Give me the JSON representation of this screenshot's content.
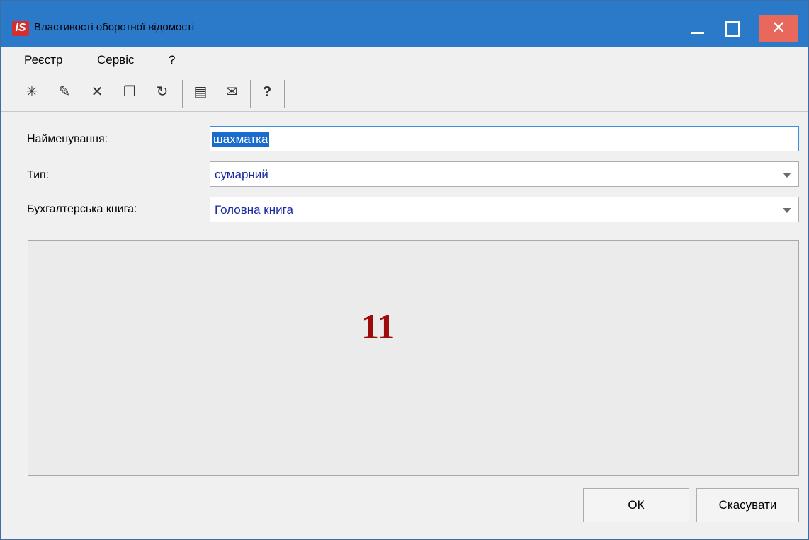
{
  "window": {
    "title": "Властивості оборотної відомості",
    "logo_text": "IS",
    "close_symbol": "✕"
  },
  "menu": {
    "items": [
      "Реєстр",
      "Сервіс",
      "?"
    ]
  },
  "toolbar": {
    "icons": [
      "new-doc-icon",
      "edit-doc-icon",
      "delete-doc-icon",
      "copy-doc-icon",
      "refresh-icon",
      "document-icon",
      "mail-icon",
      "help-icon"
    ],
    "glyphs": [
      "✳",
      "✎",
      "✕",
      "❐",
      "↻",
      "▤",
      "✉",
      "?"
    ]
  },
  "form": {
    "name_label": "Найменування:",
    "name_value": "шахматка",
    "type_label": "Тип:",
    "type_value": "сумарний",
    "book_label": "Бухгалтерська книга:",
    "book_value": "Головна книга"
  },
  "panel": {
    "badge": "11"
  },
  "buttons": {
    "ok": "ОК",
    "cancel": "Скасувати"
  },
  "colors": {
    "titlebar": "#2b79c9",
    "close": "#e8695b",
    "selection": "#1a6bcb",
    "badge": "#9e0b0b"
  }
}
